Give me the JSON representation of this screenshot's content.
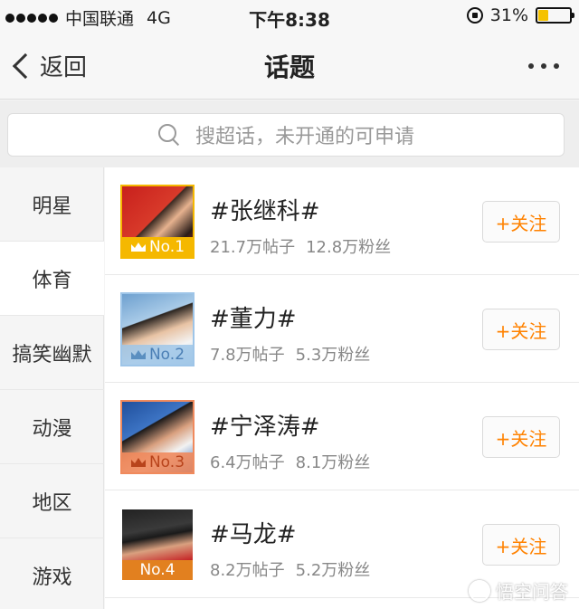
{
  "status_bar": {
    "carrier": "中国联通",
    "network": "4G",
    "time": "下午8:38",
    "battery_percent_text": "31%",
    "battery_level": 0.31
  },
  "nav": {
    "back_label": "返回",
    "title": "话题"
  },
  "search": {
    "placeholder": "搜超话，未开通的可申请"
  },
  "sidebar": {
    "items": [
      {
        "label": "明星",
        "active": false
      },
      {
        "label": "体育",
        "active": true
      },
      {
        "label": "搞笑幽默",
        "active": false
      },
      {
        "label": "动漫",
        "active": false
      },
      {
        "label": "地区",
        "active": false
      },
      {
        "label": "游戏",
        "active": false
      }
    ]
  },
  "topics": [
    {
      "title": "#张继科#",
      "posts": "21.7万帖子",
      "fans": "12.8万粉丝",
      "rank": "No.1",
      "follow_label": "+关注",
      "badge_color": "#f5b800"
    },
    {
      "title": "#董力#",
      "posts": "7.8万帖子",
      "fans": "5.3万粉丝",
      "rank": "No.2",
      "follow_label": "+关注",
      "badge_color": "#9ec5e8"
    },
    {
      "title": "#宁泽涛#",
      "posts": "6.4万帖子",
      "fans": "8.1万粉丝",
      "rank": "No.3",
      "follow_label": "+关注",
      "badge_color": "#f08a5d"
    },
    {
      "title": "#马龙#",
      "posts": "8.2万帖子",
      "fans": "5.2万粉丝",
      "rank": "No.4",
      "follow_label": "+关注",
      "badge_color": "#e2801f"
    }
  ],
  "watermark": {
    "text": "悟空问答"
  },
  "colors": {
    "accent": "#ff8200"
  }
}
